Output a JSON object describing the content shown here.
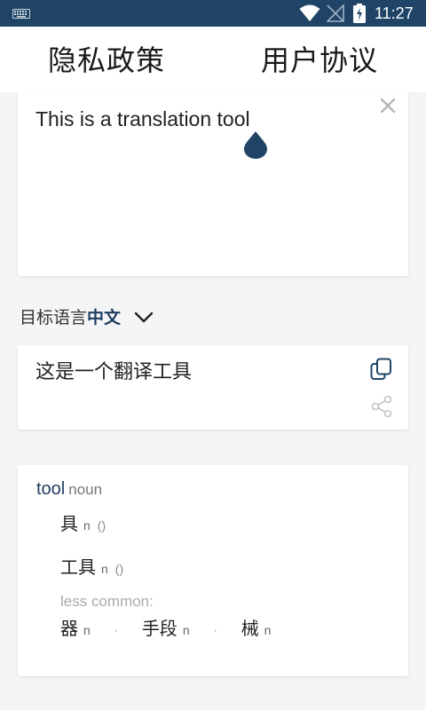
{
  "status_bar": {
    "time": "11:27",
    "icons": [
      "keyboard-icon",
      "wifi-icon",
      "no-signal-icon",
      "battery-charging-icon"
    ],
    "background": "#1f4466"
  },
  "header": {
    "privacy_link": "隐私政策",
    "agreement_link": "用户协议"
  },
  "input": {
    "text": "This is a translation tool",
    "clear_icon": "close-icon"
  },
  "target_language": {
    "label": "目标语言",
    "value": "中文",
    "icon": "chevron-down-icon"
  },
  "result": {
    "text": "这是一个翻译工具",
    "copy_icon": "copy-icon",
    "share_icon": "share-icon"
  },
  "dictionary": {
    "word": "tool",
    "pos": "noun",
    "translations": [
      {
        "zh": "具",
        "pos": "n",
        "note": "()"
      },
      {
        "zh": "工具",
        "pos": "n",
        "note": "()"
      }
    ],
    "less_common_label": "less common:",
    "less_common": [
      {
        "zh": "器",
        "pos": "n"
      },
      {
        "zh": "手段",
        "pos": "n"
      },
      {
        "zh": "械",
        "pos": "n"
      }
    ],
    "separator": "·"
  },
  "colors": {
    "accent": "#1f3c5e",
    "background": "#f4f5f7",
    "card": "#ffffff"
  }
}
